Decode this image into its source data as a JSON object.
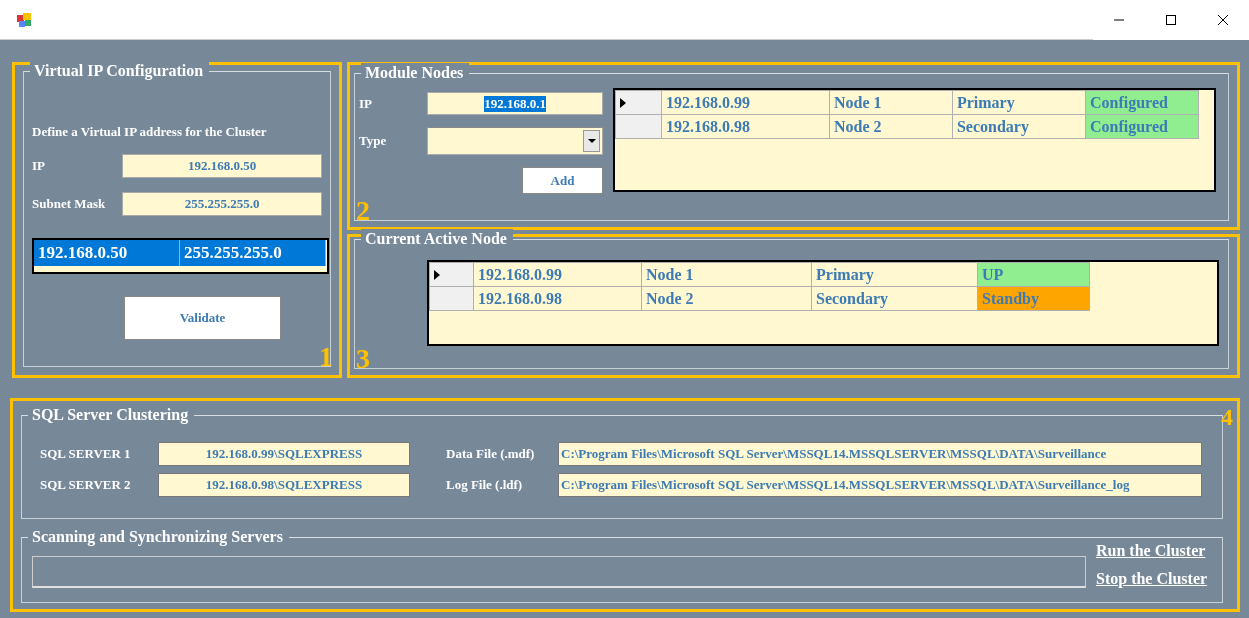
{
  "virtual_ip": {
    "title": "Virtual IP Configuration",
    "description": "Define a Virtual IP address for the Cluster",
    "ip_label": "IP",
    "ip_value": "192.168.0.50",
    "mask_label": "Subnet Mask",
    "mask_value": "255.255.255.0",
    "rows": [
      {
        "selected": true,
        "cells": [
          "192.168.0.50",
          "255.255.255.0"
        ]
      }
    ],
    "validate_button": "Validate",
    "number": "1"
  },
  "module_nodes": {
    "title": "Module Nodes",
    "ip_label": "IP",
    "ip_value": "192.168.0.1",
    "ip_text_selected": true,
    "type_label": "Type",
    "add_button": "Add",
    "number": "2",
    "rows": [
      {
        "current": true,
        "ip": "192.168.0.99",
        "node": "Node 1",
        "role": "Primary",
        "status": "Configured",
        "color": "#90ee90"
      },
      {
        "current": false,
        "ip": "192.168.0.98",
        "node": "Node 2",
        "role": "Secondary",
        "status": "Configured",
        "color": "#90ee90"
      }
    ]
  },
  "active_node": {
    "title": "Current Active Node",
    "number": "3",
    "rows": [
      {
        "current": true,
        "ip": "192.168.0.99",
        "node": "Node 1",
        "role": "Primary",
        "status": "UP",
        "color": "#90ee90"
      },
      {
        "current": false,
        "ip": "192.168.0.98",
        "node": "Node 2",
        "role": "Secondary",
        "status": "Standby",
        "color": "#ffa500"
      }
    ]
  },
  "sql_clustering": {
    "title": "SQL Server Clustering",
    "number": "4",
    "server1_label": "SQL SERVER 1",
    "server1_value": "192.168.0.99\\SQLEXPRESS",
    "server2_label": "SQL SERVER 2",
    "server2_value": "192.168.0.98\\SQLEXPRESS",
    "data_label": "Data File (.mdf)",
    "data_value": "C:\\Program Files\\Microsoft SQL Server\\MSSQL14.MSSQLSERVER\\MSSQL\\DATA\\Surveillance",
    "log_label": "Log File (.ldf)",
    "log_value": "C:\\Program Files\\Microsoft SQL Server\\MSSQL14.MSSQLSERVER\\MSSQL\\DATA\\Surveillance_log"
  },
  "scanning": {
    "title": "Scanning and Synchronizing Servers",
    "progress": {
      "level": 0
    },
    "run_link": "Run the Cluster",
    "stop_link": "Stop the Cluster"
  }
}
